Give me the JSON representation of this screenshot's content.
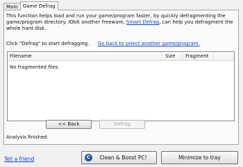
{
  "tabs": [
    {
      "label": "Main"
    },
    {
      "label": "Game Defrag"
    }
  ],
  "description": {
    "part1": "This function helps load and run your game/program faster, by quickly defragmenting the game/program directory. IObit another freeware, ",
    "link": "Smart Defrag",
    "part2": ", can help you defragment the whole hard disk."
  },
  "hint": {
    "text": "Click \"Defrag\" to start defragging.",
    "link": "Go back to select another game/program."
  },
  "list": {
    "columns": {
      "filename": "Filename",
      "size": "Size",
      "fragment": "Fragment"
    },
    "empty_message": "No fragmented files."
  },
  "buttons": {
    "back": "<< Back",
    "defrag": "Defrag",
    "clean_boost": "Clean & Boost PC!",
    "minimize": "Minimize to tray"
  },
  "status": "Analysis finished.",
  "footer": {
    "tell_friend": "Tell a friend"
  },
  "icons": {
    "boost": "boost-icon"
  },
  "colors": {
    "link": "#0b46c8",
    "boost_icon": "#1f56b6"
  }
}
